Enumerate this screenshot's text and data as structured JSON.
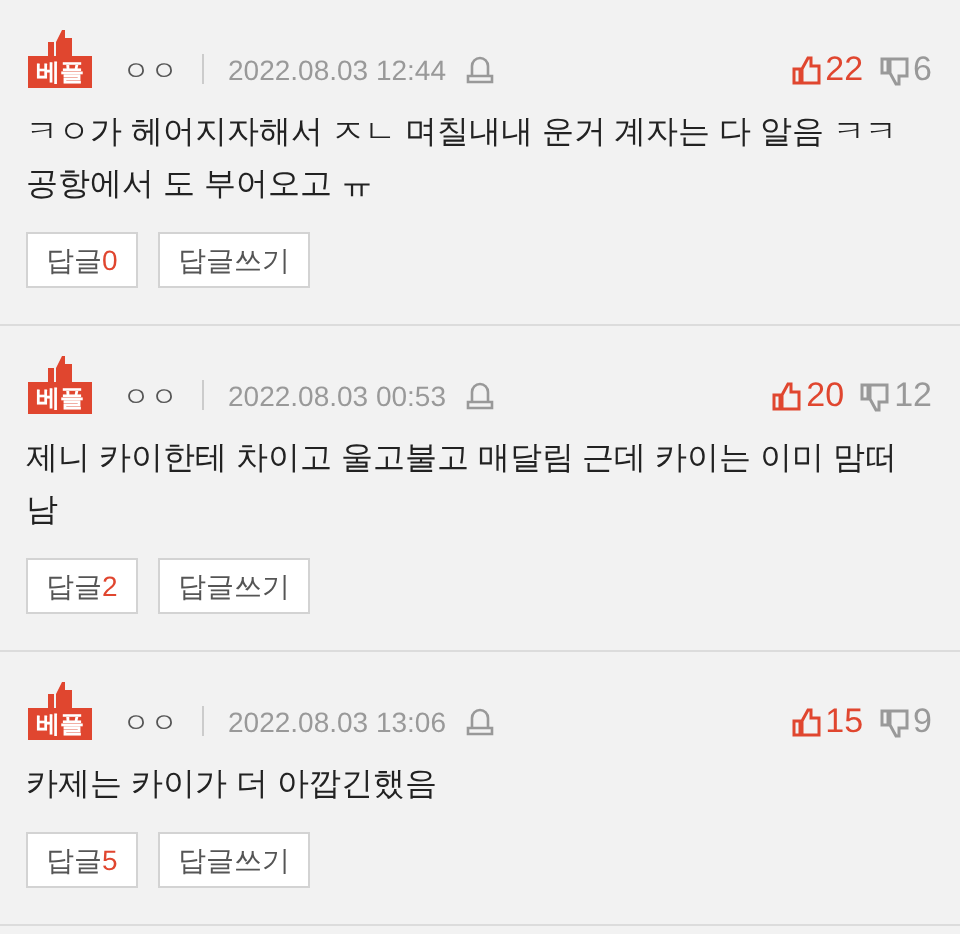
{
  "comments": [
    {
      "badge": "베플",
      "author": "ㅇㅇ",
      "date": "2022.08.03 12:44",
      "likes": "22",
      "dislikes": "6",
      "text": "ㅋㅇ가 헤어지자해서 ㅈㄴ 며칠내내 운거 계자는 다 알음 ㅋㅋ공항에서 도 부어오고 ㅠ",
      "reply_label": "답글",
      "reply_count": "0",
      "write_label": "답글쓰기"
    },
    {
      "badge": "베플",
      "author": "ㅇㅇ",
      "date": "2022.08.03 00:53",
      "likes": "20",
      "dislikes": "12",
      "text": "제니 카이한테 차이고 울고불고 매달림 근데 카이는 이미 맘떠남",
      "reply_label": "답글",
      "reply_count": "2",
      "write_label": "답글쓰기"
    },
    {
      "badge": "베플",
      "author": "ㅇㅇ",
      "date": "2022.08.03 13:06",
      "likes": "15",
      "dislikes": "9",
      "text": "카제는 카이가 더 아깝긴했음",
      "reply_label": "답글",
      "reply_count": "5",
      "write_label": "답글쓰기"
    }
  ]
}
